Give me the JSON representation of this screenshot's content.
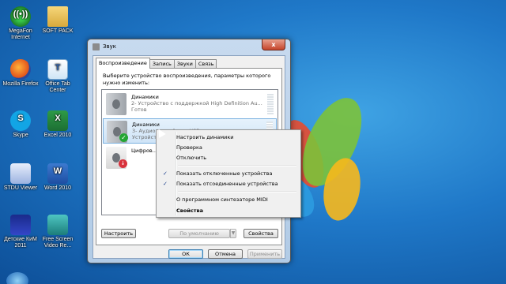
{
  "desktop": {
    "icons": [
      {
        "label": "MegaFon Internet",
        "icon": "megafon-icon"
      },
      {
        "label": "SOFT PACK",
        "icon": "folder-icon"
      },
      {
        "label": "Mozilla Firefox",
        "icon": "firefox-icon"
      },
      {
        "label": "Office Tab Center",
        "icon": "office-tab-icon"
      },
      {
        "label": "Skype",
        "icon": "skype-icon"
      },
      {
        "label": "Excel 2010",
        "icon": "excel-icon"
      },
      {
        "label": "STDU Viewer",
        "icon": "stdu-viewer-icon"
      },
      {
        "label": "Word 2010",
        "icon": "word-icon"
      },
      {
        "label": "Детские КиМ 2011",
        "icon": "kids-app-icon"
      },
      {
        "label": "Free Screen Video Re...",
        "icon": "screen-recorder-icon"
      }
    ]
  },
  "dialog": {
    "title": "Звук",
    "close_glyph": "x",
    "tabs": [
      "Воспроизведение",
      "Запись",
      "Звуки",
      "Связь"
    ],
    "instructions": "Выберите устройство воспроизведения, параметры которого нужно изменить:",
    "devices": [
      {
        "name": "Динамики",
        "description": "2- Устройство с поддержкой High Definition Au...",
        "status": "Готов"
      },
      {
        "name": "Динамики",
        "description": "3- Аудио устройства USB",
        "status": "Устройство по умолчанию"
      },
      {
        "name": "Цифров...",
        "description": "",
        "status": ""
      }
    ],
    "buttons": {
      "configure": "Настроить",
      "set_default": "По умолчанию",
      "properties": "Свойства",
      "ok": "ОК",
      "cancel": "Отмена",
      "apply": "Применить"
    }
  },
  "context_menu": {
    "items": [
      {
        "label": "Настроить динамики",
        "checked": false,
        "bold": false
      },
      {
        "label": "Проверка",
        "checked": false,
        "bold": false
      },
      {
        "label": "Отключить",
        "checked": false,
        "bold": false
      },
      {
        "label": "Показать отключенные устройства",
        "checked": true,
        "bold": false
      },
      {
        "label": "Показать отсоединенные устройства",
        "checked": true,
        "bold": false
      },
      {
        "label": "О программном синтезаторе MIDI",
        "checked": false,
        "bold": false
      },
      {
        "label": "Свойства",
        "checked": false,
        "bold": true
      }
    ],
    "check_glyph": "✓"
  },
  "colors": {
    "wallpaper": "#1f78c8",
    "selection": "#cfe4f7",
    "default_check": "#23a634"
  }
}
